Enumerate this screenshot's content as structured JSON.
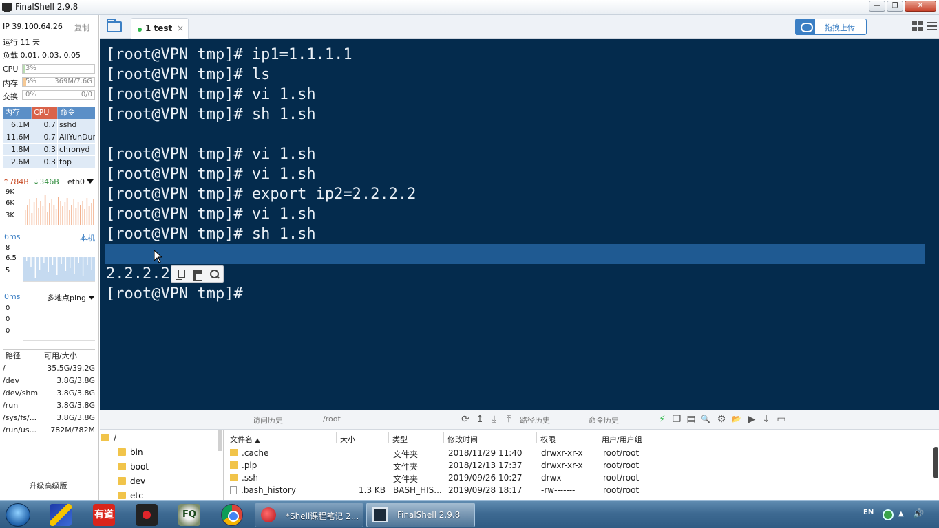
{
  "window": {
    "title": "FinalShell 2.9.8",
    "min": "—",
    "max": "❐",
    "close": "✕"
  },
  "sidebar": {
    "ip": "IP 39.100.64.26",
    "copy_label": "复制",
    "uptime": "运行 11 天",
    "load": "负载 0.01, 0.03, 0.05",
    "cpu": {
      "label": "CPU",
      "text": "3%",
      "level": 0.03
    },
    "mem": {
      "label": "内存",
      "text": "5%",
      "right": "369M/7.6G",
      "level": 0.05
    },
    "swap": {
      "label": "交换",
      "text": "0%",
      "right": "0/0",
      "level": 0
    },
    "process_headers": [
      "内存",
      "CPU",
      "命令"
    ],
    "processes": [
      {
        "mem": "6.1M",
        "cpu": "0.7",
        "cmd": "sshd"
      },
      {
        "mem": "11.6M",
        "cpu": "0.7",
        "cmd": "AliYunDun"
      },
      {
        "mem": "1.8M",
        "cpu": "0.3",
        "cmd": "chronyd"
      },
      {
        "mem": "2.6M",
        "cpu": "0.3",
        "cmd": "top"
      }
    ],
    "net": {
      "up": "↑784B",
      "down": "↓346B",
      "iface": "eth0",
      "axis": [
        "9K",
        "6K",
        "3K"
      ]
    },
    "latency": {
      "ms": "6ms",
      "host": "本机",
      "axis": [
        "8",
        "6.5",
        "5"
      ]
    },
    "ping": {
      "ms": "0ms",
      "label": "多地点ping",
      "axis": [
        "0",
        "0",
        "0"
      ]
    },
    "disk_headers": [
      "路径",
      "可用/大小"
    ],
    "disks": [
      {
        "path": "/",
        "size": "35.5G/39.2G"
      },
      {
        "path": "/dev",
        "size": "3.8G/3.8G"
      },
      {
        "path": "/dev/shm",
        "size": "3.8G/3.8G"
      },
      {
        "path": "/run",
        "size": "3.8G/3.8G"
      },
      {
        "path": "/sys/fs/...",
        "size": "3.8G/3.8G"
      },
      {
        "path": "/run/us...",
        "size": "782M/782M"
      }
    ],
    "upgrade": "升级高级版"
  },
  "tabs": {
    "active_label": "1 test",
    "close": "×"
  },
  "upload": {
    "label": "拖拽上传"
  },
  "terminal": {
    "lines": [
      "[root@VPN tmp]# ip1=1.1.1.1",
      "[root@VPN tmp]# ls",
      "[root@VPN tmp]# vi 1.sh",
      "[root@VPN tmp]# sh 1.sh",
      "",
      "[root@VPN tmp]# vi 1.sh",
      "[root@VPN tmp]# vi 1.sh",
      "[root@VPN tmp]# export ip2=2.2.2.2",
      "[root@VPN tmp]# vi 1.sh",
      "[root@VPN tmp]# sh 1.sh",
      "",
      "2.2.2.2",
      "[root@VPN tmp]#"
    ]
  },
  "toolbar": {
    "history": "访问历史",
    "path": "/root",
    "path_history": "路径历史",
    "cmd_history": "命令历史",
    "icons": [
      "⟳",
      "↥",
      "⤓",
      "⤒"
    ],
    "right_icons": [
      "⚡",
      "❐",
      "▤",
      "🔍",
      "⚙",
      "📂",
      "▶",
      "↓",
      "▭"
    ]
  },
  "tree": {
    "root": "/",
    "items": [
      "bin",
      "boot",
      "dev",
      "etc"
    ]
  },
  "files": {
    "headers": [
      "文件名",
      "大小",
      "类型",
      "修改时间",
      "权限",
      "用户/用户组"
    ],
    "rows": [
      {
        "name": ".cache",
        "size": "",
        "type": "文件夹",
        "mtime": "2018/11/29 11:40",
        "perm": "drwxr-xr-x",
        "owner": "root/root",
        "folder": true
      },
      {
        "name": ".pip",
        "size": "",
        "type": "文件夹",
        "mtime": "2018/12/13 17:37",
        "perm": "drwxr-xr-x",
        "owner": "root/root",
        "folder": true
      },
      {
        "name": ".ssh",
        "size": "",
        "type": "文件夹",
        "mtime": "2019/09/26 10:27",
        "perm": "drwx------",
        "owner": "root/root",
        "folder": true
      },
      {
        "name": ".bash_history",
        "size": "1.3 KB",
        "type": "BASH_HIS...",
        "mtime": "2019/09/28 18:17",
        "perm": "-rw-------",
        "owner": "root/root",
        "folder": false
      }
    ]
  },
  "taskbar": {
    "youdao": "有道",
    "feiq": "FQ",
    "task_shell": "*Shell课程笔记 2...",
    "task_final": "FinalShell 2.9.8",
    "lang": "EN",
    "up": "▲",
    "vol": "🔊"
  },
  "colors": {
    "terminal_bg": "#042b4d",
    "selection": "#1f5a92",
    "accent": "#3b7fc4"
  }
}
